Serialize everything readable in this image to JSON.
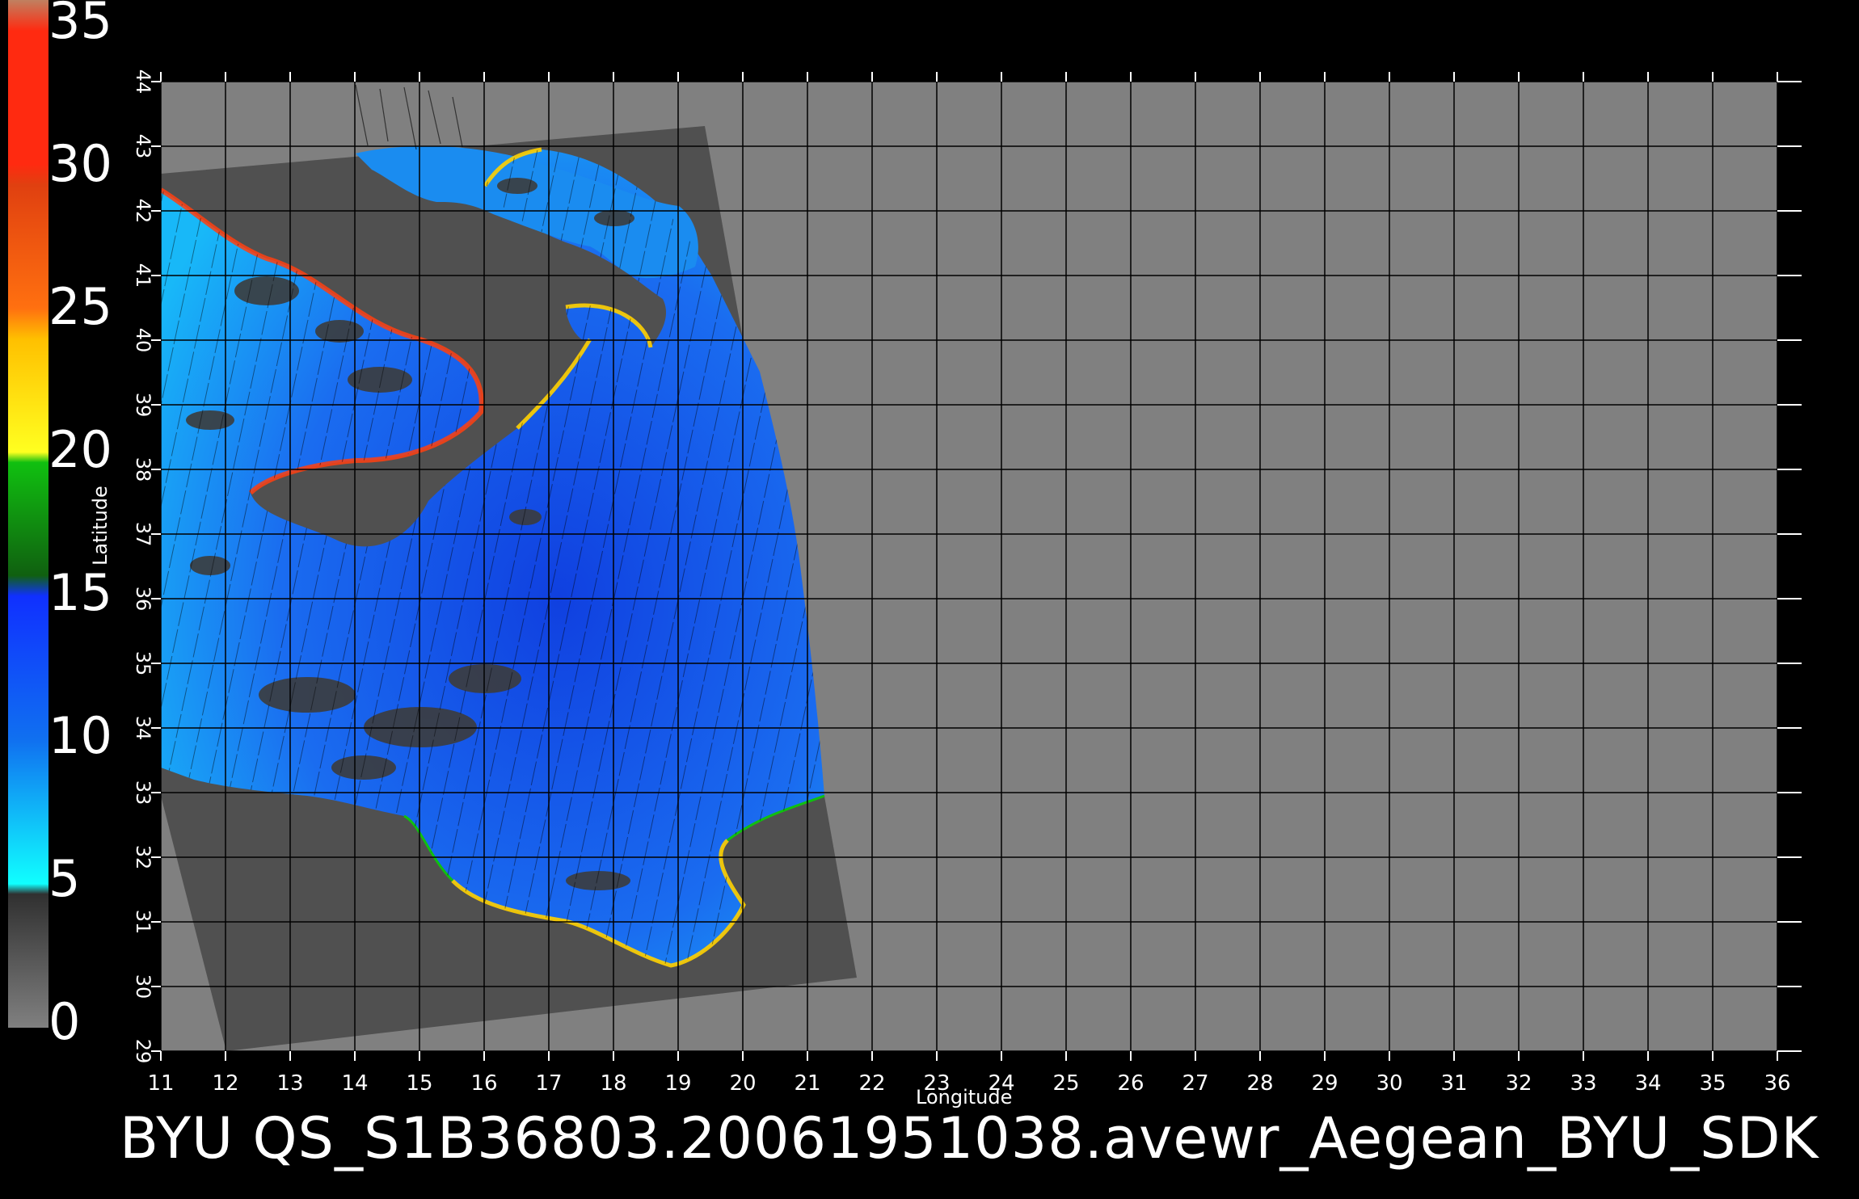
{
  "map": {
    "x_axis": {
      "label": "Longitude",
      "ticks": [
        "11",
        "12",
        "13",
        "14",
        "15",
        "16",
        "17",
        "18",
        "19",
        "20",
        "21",
        "22",
        "23",
        "24",
        "25",
        "26",
        "27",
        "28",
        "29",
        "30",
        "31",
        "32",
        "33",
        "34",
        "35",
        "36"
      ]
    },
    "y_axis": {
      "label": "Latitude",
      "ticks": [
        "29",
        "30",
        "31",
        "32",
        "33",
        "34",
        "35",
        "36",
        "37",
        "38",
        "39",
        "40",
        "41",
        "42",
        "43",
        "44"
      ]
    },
    "title": "BYU  QS_S1B36803.20061951038.avewr_Aegean_BYU_SDK",
    "colors": {
      "background": "#000000",
      "frame": "#808080",
      "swath": "#505050",
      "land": "#3c3c3c",
      "grid": "#000000"
    }
  },
  "colorbar": {
    "labels": [
      "35",
      "30",
      "25",
      "20",
      "15",
      "10",
      "5",
      "0"
    ],
    "bands": [
      {
        "from": 35,
        "to": 34,
        "color": "#c08060"
      },
      {
        "from": 34,
        "to": 30,
        "color": "#ff1a10"
      },
      {
        "from": 30,
        "to": 25,
        "color": "#ff5a10"
      },
      {
        "from": 25,
        "to": 20,
        "color": "#ffcc00"
      },
      {
        "from": 20,
        "to": 15,
        "color": "#10c010"
      },
      {
        "from": 15,
        "to": 10,
        "color": "#1040ff"
      },
      {
        "from": 10,
        "to": 5,
        "color": "#10c8ff"
      },
      {
        "from": 5,
        "to": 0,
        "color": "#606060"
      }
    ]
  }
}
